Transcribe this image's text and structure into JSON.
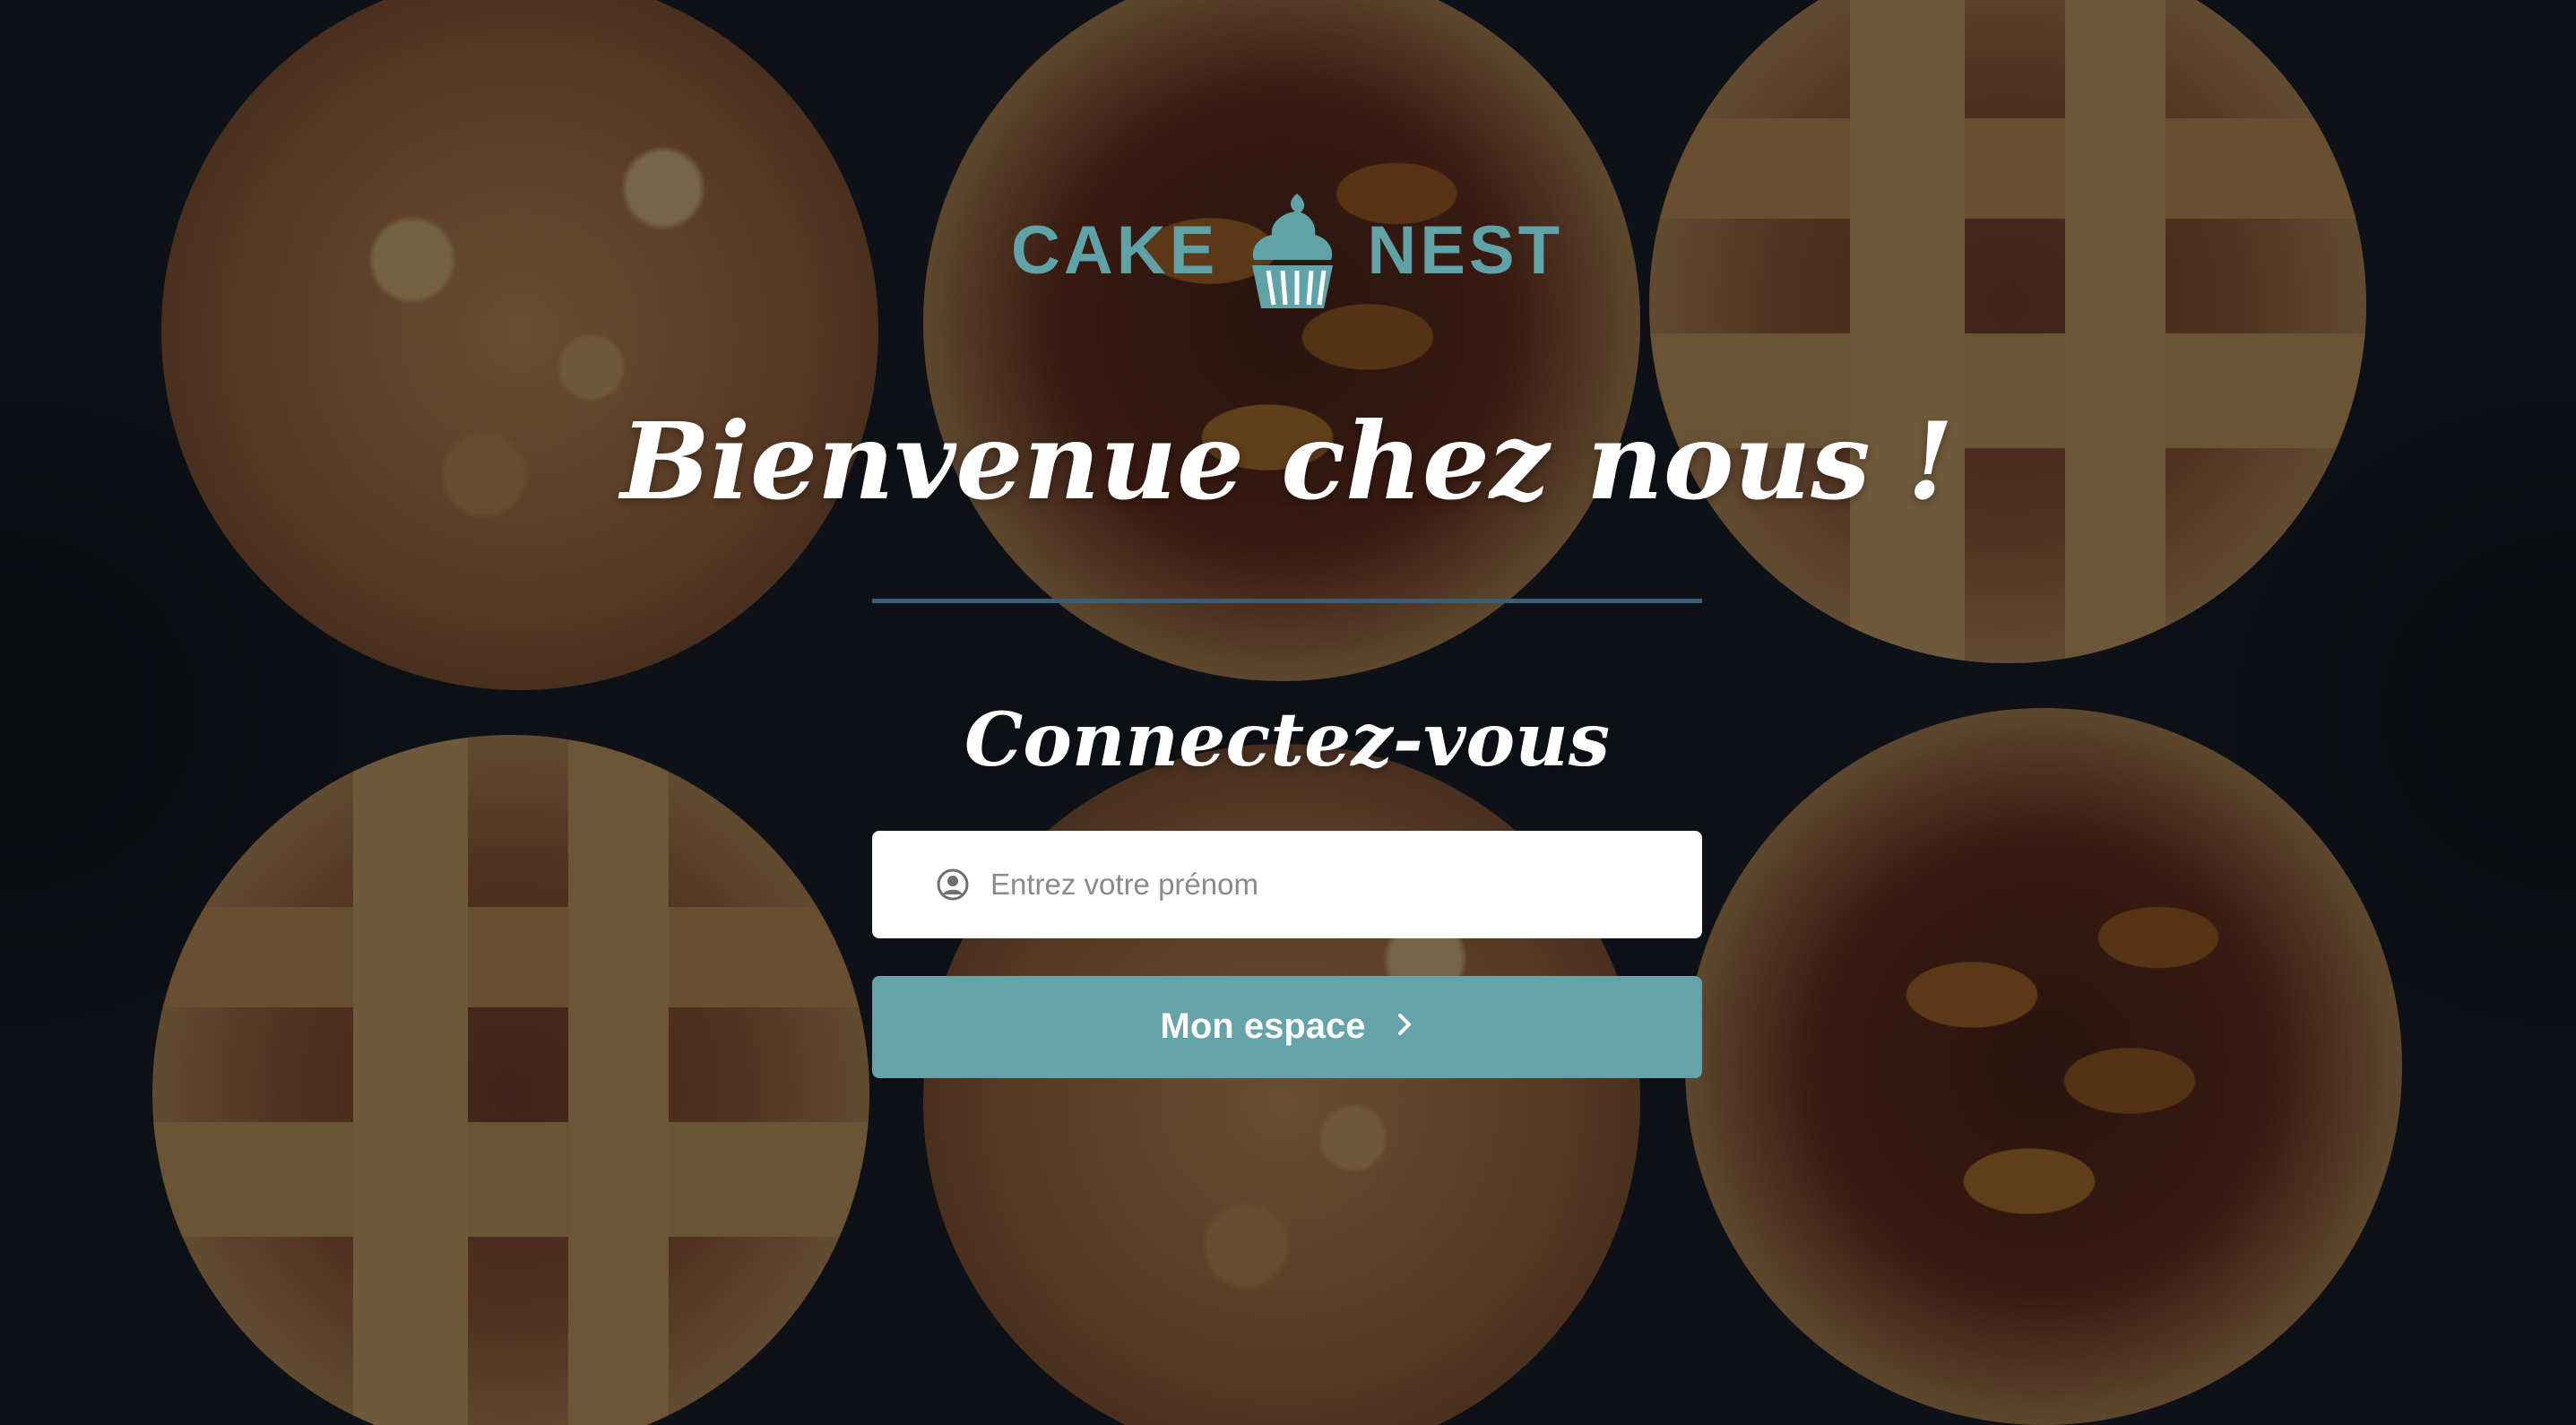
{
  "brand": {
    "left": "CAKE",
    "right": "NEST",
    "logo_icon": "cupcake-icon",
    "accent_color": "#5fa3a9"
  },
  "welcome": {
    "title": "Bienvenue chez nous !"
  },
  "login": {
    "title": "Connectez-vous",
    "input_icon": "user-circle-icon",
    "input_placeholder": "Entrez votre prénom",
    "input_value": "",
    "button_label": "Mon espace",
    "button_icon": "chevron-right-icon",
    "button_color": "#64a3a9",
    "divider_color": "#3a5d78"
  }
}
